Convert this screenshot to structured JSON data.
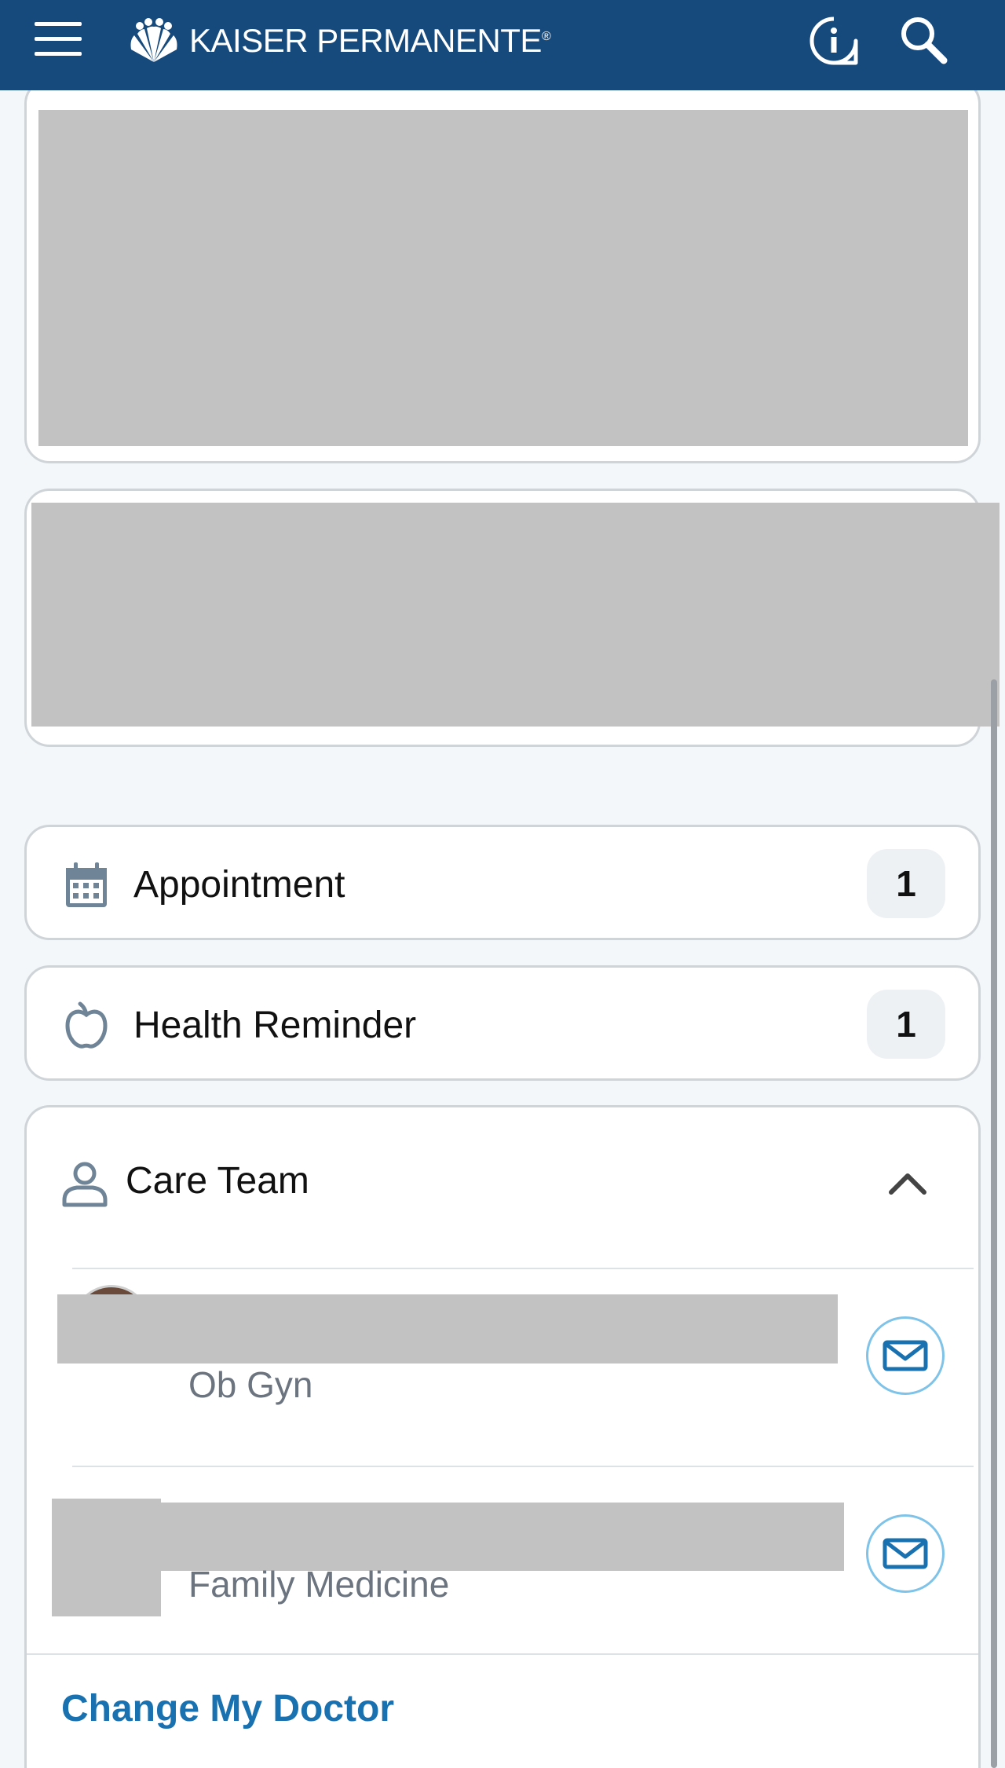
{
  "header": {
    "brand_name": "KAISER PERMANENTE",
    "brand_mark": "®",
    "icons": [
      "menu-icon",
      "info-icon",
      "search-icon"
    ],
    "color": "#174a7c"
  },
  "summary_rows": [
    {
      "label": "Appointment",
      "count": "1",
      "icon": "calendar-icon"
    },
    {
      "label": "Health Reminder",
      "count": "1",
      "icon": "apple-icon"
    }
  ],
  "care_team": {
    "title": "Care Team",
    "icon": "person-icon",
    "members": [
      {
        "specialty": "Ob Gyn"
      },
      {
        "specialty": "Family Medicine"
      }
    ],
    "change_doctor_label": "Change My Doctor"
  },
  "colors": {
    "accent_link": "#1a71b0",
    "mail_ring": "#7fc3e8",
    "background": "#f3f7fa"
  }
}
